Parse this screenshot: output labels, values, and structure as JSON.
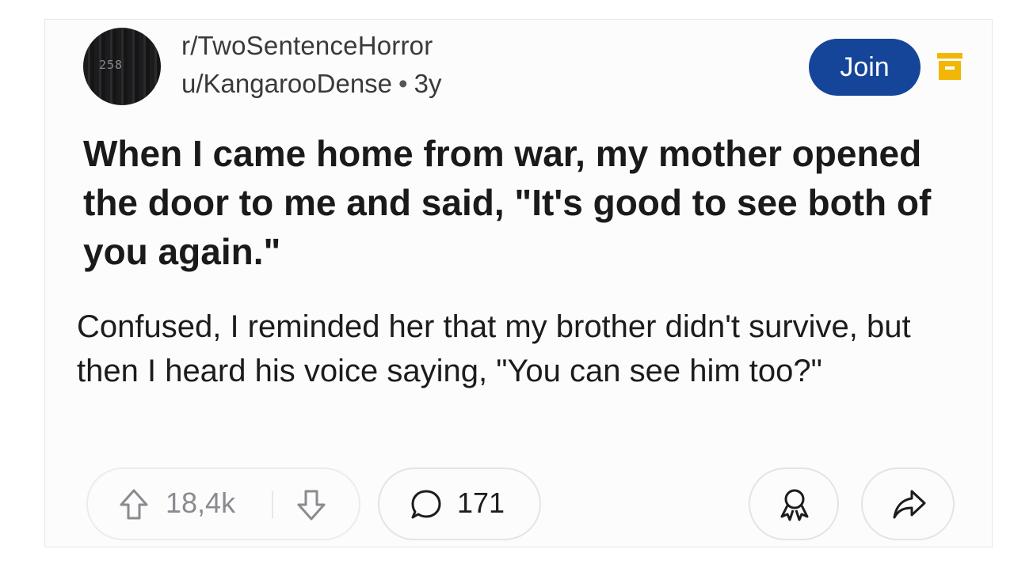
{
  "post": {
    "subreddit": "r/TwoSentenceHorror",
    "author": "u/KangarooDense",
    "separator": "•",
    "age": "3y",
    "avatar_text": "258",
    "join_label": "Join",
    "title": "When I came home from war, my mother opened the door to me and said, \"It's good to see both of you again.\"",
    "body": "Confused, I reminded her that my brother didn't survive, but then I heard his voice saying, \"You can see him too?\""
  },
  "actions": {
    "upvote_icon": "arrow-up-icon",
    "vote_count": "18,4k",
    "downvote_icon": "arrow-down-icon",
    "comment_icon": "speech-bubble-icon",
    "comment_count": "171",
    "award_icon": "award-icon",
    "share_icon": "share-arrow-icon"
  },
  "colors": {
    "join_button": "#154598",
    "menu_icon": "#f2b705",
    "muted_text": "#8a8a8f"
  }
}
